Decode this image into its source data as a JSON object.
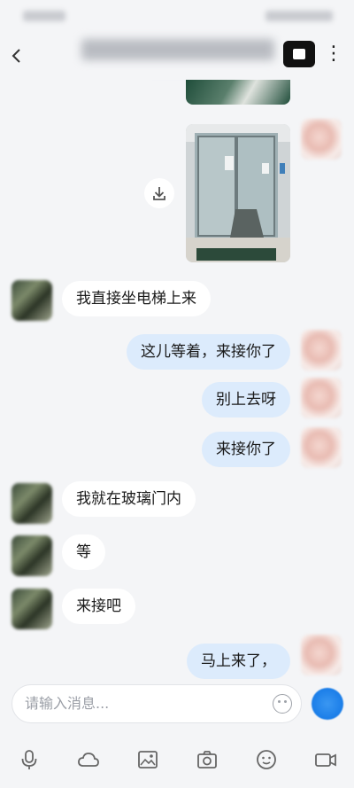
{
  "messages": [
    {
      "side": "peer",
      "text": "我直接坐电梯上来"
    },
    {
      "side": "me",
      "text": "这儿等着，来接你了"
    },
    {
      "side": "me",
      "text": "别上去呀"
    },
    {
      "side": "me",
      "text": "来接你了"
    },
    {
      "side": "peer",
      "text": "我就在玻璃门内"
    },
    {
      "side": "peer",
      "text": "等"
    },
    {
      "side": "peer",
      "text": "来接吧"
    },
    {
      "side": "me",
      "text": "马上来了，"
    }
  ],
  "input": {
    "placeholder": "请输入消息..."
  },
  "toolbar": {
    "items": [
      "microphone-icon",
      "cloud-icon",
      "image-icon",
      "camera-icon",
      "emoji-icon",
      "video-icon"
    ]
  },
  "colors": {
    "accent": "#1a7de8",
    "my_bubble": "#dcebfc",
    "peer_bubble": "#ffffff",
    "background": "#f4f5f7"
  }
}
